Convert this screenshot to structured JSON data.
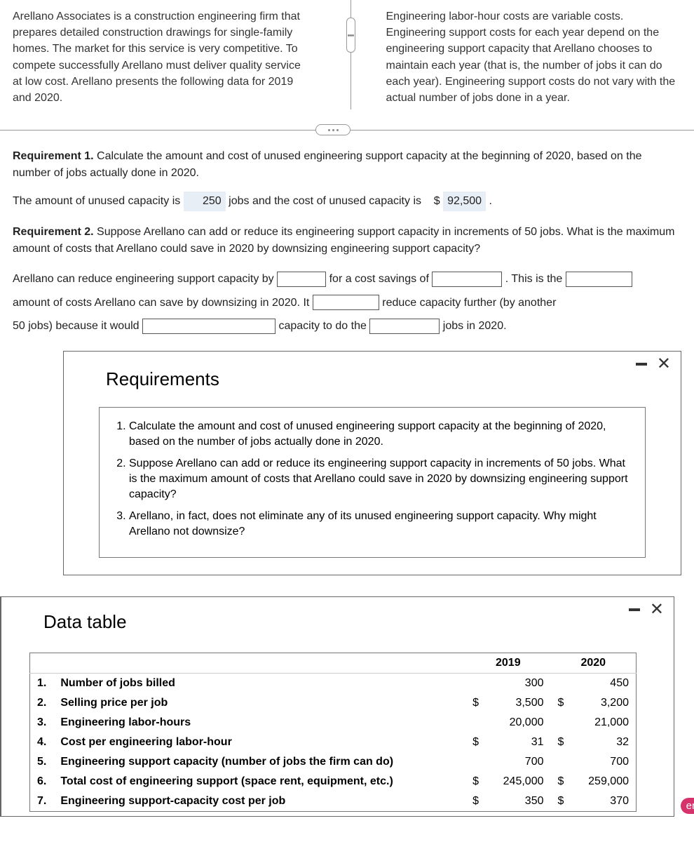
{
  "intro": {
    "left": "Arellano Associates is a construction engineering firm that prepares detailed construction drawings for single-family homes. The market for this service is very competitive. To compete successfully Arellano must deliver quality service at low cost. Arellano presents the following data for 2019 and 2020.",
    "right": "Engineering labor-hour costs are variable costs. Engineering support costs for each year depend on the engineering support capacity that Arellano chooses to maintain each year (that is, the number of jobs it can do each year). Engineering support costs do not vary with the actual number of jobs done in a year."
  },
  "req1": {
    "head": "Requirement 1.",
    "text": " Calculate the amount and cost of unused engineering support capacity at the beginning of 2020, based on the number of jobs actually done in 2020.",
    "s1a": "The amount of unused capacity is",
    "v1": "250",
    "s1b": "jobs and the cost of unused capacity is",
    "s1c": "$",
    "v2": "92,500",
    "s1d": "."
  },
  "req2": {
    "head": "Requirement 2.",
    "text": " Suppose Arellano can add or reduce its engineering support capacity in increments of 50 jobs. What is the maximum amount of costs that Arellano could save in 2020 by downsizing engineering support capacity?",
    "l1": "Arellano can reduce engineering support capacity by",
    "l2": "for a cost savings of",
    "l3": ". This is the",
    "l4": "amount of costs Arellano can save by downsizing in 2020. It",
    "l5": "reduce capacity further (by another",
    "l6": "50 jobs) because it would",
    "l7": "capacity to do the",
    "l8": "jobs in 2020."
  },
  "modal1": {
    "title": "Requirements",
    "items": [
      "Calculate the amount and cost of unused engineering support capacity at the beginning of 2020, based on the number of jobs actually done in 2020.",
      "Suppose Arellano can add or reduce its engineering support capacity in increments of 50 jobs. What is the maximum amount of costs that Arellano could save in 2020 by downsizing engineering support capacity?",
      "Arellano, in fact, does not eliminate any of its unused engineering support capacity. Why might Arellano not downsize?"
    ]
  },
  "modal2": {
    "title": "Data table",
    "headers": [
      "",
      "2019",
      "2020"
    ],
    "rows": [
      {
        "n": "1.",
        "label": "Number of jobs billed",
        "c19": "",
        "v19": "300",
        "c20": "",
        "v20": "450"
      },
      {
        "n": "2.",
        "label": "Selling price per job",
        "c19": "$",
        "v19": "3,500",
        "c20": "$",
        "v20": "3,200"
      },
      {
        "n": "3.",
        "label": "Engineering labor-hours",
        "c19": "",
        "v19": "20,000",
        "c20": "",
        "v20": "21,000"
      },
      {
        "n": "4.",
        "label": "Cost per engineering labor-hour",
        "c19": "$",
        "v19": "31",
        "c20": "$",
        "v20": "32"
      },
      {
        "n": "5.",
        "label": "Engineering support capacity (number of jobs the firm can do)",
        "c19": "",
        "v19": "700",
        "c20": "",
        "v20": "700"
      },
      {
        "n": "6.",
        "label": "Total cost of engineering support (space rent, equipment, etc.)",
        "c19": "$",
        "v19": "245,000",
        "c20": "$",
        "v20": "259,000"
      },
      {
        "n": "7.",
        "label": "Engineering support-capacity cost per job",
        "c19": "$",
        "v19": "350",
        "c20": "$",
        "v20": "370"
      }
    ]
  },
  "badge": "er"
}
